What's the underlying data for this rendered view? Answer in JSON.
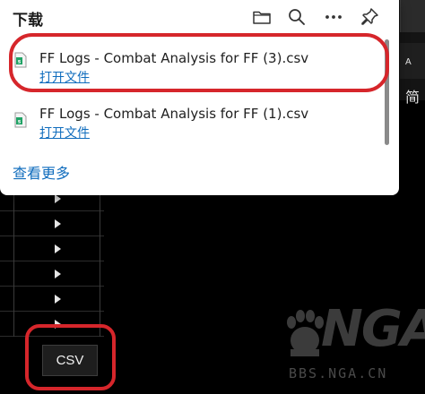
{
  "flyout": {
    "title": "下载",
    "toolbar_icons": [
      "folder-icon",
      "search-icon",
      "more-icon",
      "pin-icon"
    ],
    "items": [
      {
        "filename": "FF Logs - Combat Analysis for FF (3).csv",
        "action": "打开文件",
        "file_icon": "csv-file-icon"
      },
      {
        "filename": "FF Logs - Combat Analysis for FF (1).csv",
        "action": "打开文件",
        "file_icon": "csv-file-icon"
      }
    ],
    "see_more": "查看更多"
  },
  "background": {
    "lang_label": "简",
    "lang_prefix": "A",
    "csv_button": "CSV",
    "watermark": "NGA",
    "watermark_url": "BBS.NGA.CN"
  },
  "colors": {
    "accent_link": "#0f6cbd",
    "annotation_red": "#d6262b",
    "page_bg": "#000000"
  }
}
